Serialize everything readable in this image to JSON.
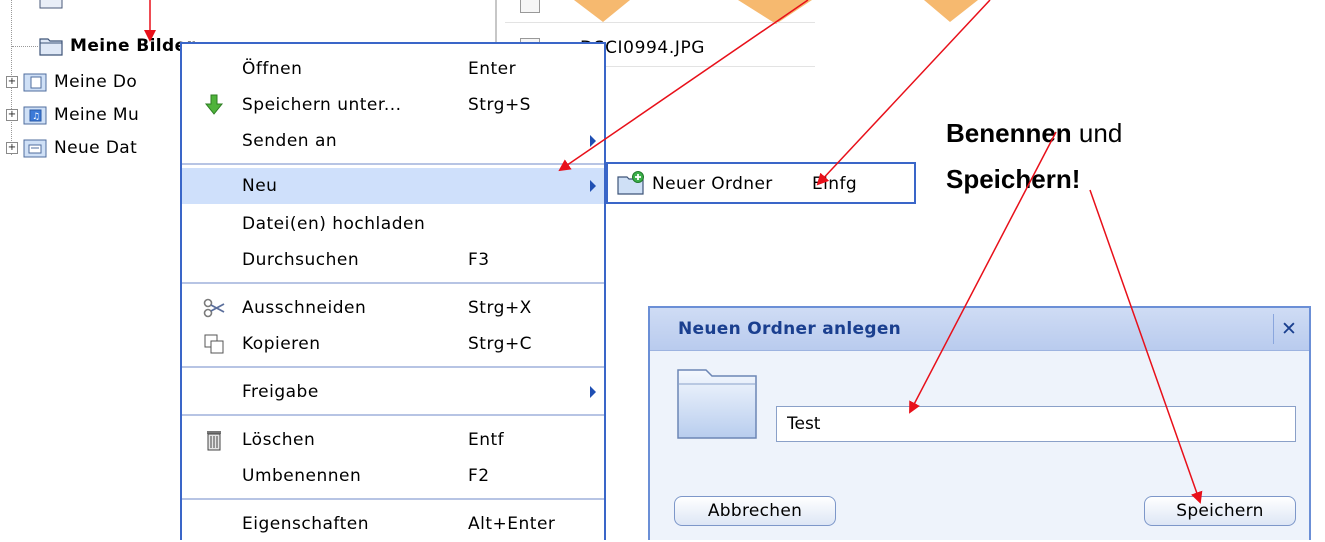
{
  "tree": {
    "items": [
      {
        "label": "Meine Bilder",
        "bold": true,
        "icon": "folder-icon"
      },
      {
        "label": "Meine Do",
        "icon": "documents-folder-icon"
      },
      {
        "label": "Meine Mu",
        "icon": "music-folder-icon"
      },
      {
        "label": "Neue Dat",
        "icon": "new-folder-icon"
      }
    ]
  },
  "files": {
    "items": [
      "DSCI0994.JPG"
    ]
  },
  "context_menu": {
    "items": [
      {
        "label": "Öffnen",
        "shortcut": "Enter",
        "icon": ""
      },
      {
        "label": "Speichern unter...",
        "shortcut": "Strg+S",
        "icon": "download-arrow-icon"
      },
      {
        "label": "Senden an",
        "shortcut": "",
        "submenu": true
      },
      {
        "label": "Neu",
        "shortcut": "",
        "submenu": true,
        "active": true
      },
      {
        "label": "Datei(en) hochladen",
        "shortcut": ""
      },
      {
        "label": "Durchsuchen",
        "shortcut": "F3"
      },
      {
        "label": "Ausschneiden",
        "shortcut": "Strg+X",
        "icon": "scissors-icon"
      },
      {
        "label": "Kopieren",
        "shortcut": "Strg+C",
        "icon": "copy-icon"
      },
      {
        "label": "Freigabe",
        "shortcut": "",
        "submenu": true
      },
      {
        "label": "Löschen",
        "shortcut": "Entf",
        "icon": "trash-icon"
      },
      {
        "label": "Umbenennen",
        "shortcut": "F2"
      },
      {
        "label": "Eigenschaften",
        "shortcut": "Alt+Enter"
      }
    ]
  },
  "submenu": {
    "label": "Neuer Ordner",
    "shortcut": "Einfg",
    "icon": "new-folder-plus-icon"
  },
  "note": {
    "line1_bold": "Benennen",
    "line1_rest": " und",
    "line2_bold": "Speichern!"
  },
  "dialog": {
    "title": "Neuen Ordner anlegen",
    "close": "✕",
    "input_value": "Test",
    "cancel_label": "Abbrechen",
    "save_label": "Speichern"
  },
  "colors": {
    "menu_border": "#3a66c8",
    "active_row": "#cfe0fb",
    "dialog_title": "#1a3f8f",
    "arrow": "#e8101a",
    "decoration": "#f6b96f"
  }
}
